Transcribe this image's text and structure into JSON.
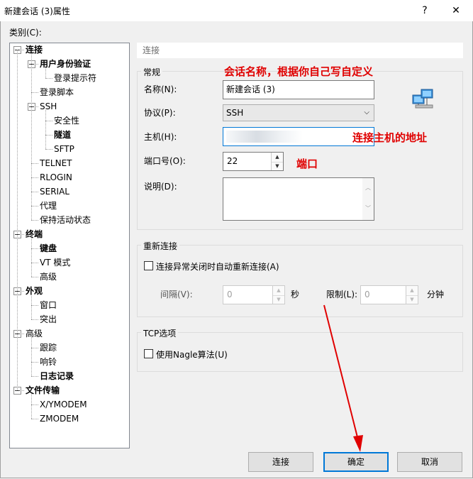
{
  "window": {
    "title": "新建会话 (3)属性",
    "help_btn": "?",
    "close_btn": "✕"
  },
  "category_label": "类别(C):",
  "tree": [
    {
      "label": "连接",
      "bold": true,
      "level": 0,
      "expander": true
    },
    {
      "label": "用户身份验证",
      "bold": true,
      "level": 1,
      "expander": true
    },
    {
      "label": "登录提示符",
      "bold": false,
      "level": 2
    },
    {
      "label": "登录脚本",
      "bold": false,
      "level": 1
    },
    {
      "label": "SSH",
      "bold": false,
      "level": 1,
      "expander": true
    },
    {
      "label": "安全性",
      "bold": false,
      "level": 2
    },
    {
      "label": "隧道",
      "bold": true,
      "level": 2
    },
    {
      "label": "SFTP",
      "bold": false,
      "level": 2
    },
    {
      "label": "TELNET",
      "bold": false,
      "level": 1
    },
    {
      "label": "RLOGIN",
      "bold": false,
      "level": 1
    },
    {
      "label": "SERIAL",
      "bold": false,
      "level": 1
    },
    {
      "label": "代理",
      "bold": false,
      "level": 1
    },
    {
      "label": "保持活动状态",
      "bold": false,
      "level": 1
    },
    {
      "label": "终端",
      "bold": true,
      "level": 0,
      "expander": true
    },
    {
      "label": "键盘",
      "bold": true,
      "level": 1
    },
    {
      "label": "VT 模式",
      "bold": false,
      "level": 1
    },
    {
      "label": "高级",
      "bold": false,
      "level": 1
    },
    {
      "label": "外观",
      "bold": true,
      "level": 0,
      "expander": true
    },
    {
      "label": "窗口",
      "bold": false,
      "level": 1
    },
    {
      "label": "突出",
      "bold": false,
      "level": 1
    },
    {
      "label": "高级",
      "bold": false,
      "level": 0,
      "expander": true
    },
    {
      "label": "跟踪",
      "bold": false,
      "level": 1
    },
    {
      "label": "响铃",
      "bold": false,
      "level": 1
    },
    {
      "label": "日志记录",
      "bold": true,
      "level": 1
    },
    {
      "label": "文件传输",
      "bold": true,
      "level": 0,
      "expander": true
    },
    {
      "label": "X/YMODEM",
      "bold": false,
      "level": 1
    },
    {
      "label": "ZMODEM",
      "bold": false,
      "level": 1
    }
  ],
  "section_header": "连接",
  "general": {
    "title": "常规",
    "name_label": "名称(N):",
    "name_value": "新建会话 (3)",
    "protocol_label": "协议(P):",
    "protocol_value": "SSH",
    "host_label": "主机(H):",
    "host_value": "",
    "port_label": "端口号(O):",
    "port_value": "22",
    "desc_label": "说明(D):",
    "desc_value": ""
  },
  "reconnect": {
    "title": "重新连接",
    "checkbox_label": "连接异常关闭时自动重新连接(A)",
    "interval_label": "间隔(V):",
    "interval_value": "0",
    "interval_unit": "秒",
    "limit_label": "限制(L):",
    "limit_value": "0",
    "limit_unit": "分钟"
  },
  "tcp": {
    "title": "TCP选项",
    "nagle_label": "使用Nagle算法(U)"
  },
  "buttons": {
    "connect": "连接",
    "ok": "确定",
    "cancel": "取消"
  },
  "annotations": {
    "name_note": "会话名称，根据你自己写自定义",
    "host_note": "连接主机的地址",
    "port_note": "端口"
  },
  "colors": {
    "annotation": "#e00000",
    "accent": "#0078d7"
  }
}
